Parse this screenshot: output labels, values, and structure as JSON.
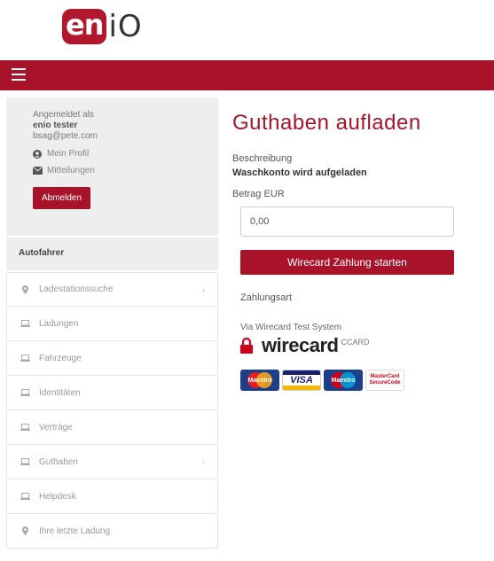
{
  "header": {
    "logo_part1": "en",
    "logo_part2": "iO"
  },
  "navbar": {
    "menu_icon": "hamburger-icon"
  },
  "user": {
    "logged_in_as": "Angemeldet als",
    "name": "enio tester",
    "email": "bsag@pete.com",
    "profile_label": "Mein Profil",
    "messages_label": "Mitteilungen",
    "logout_label": "Abmelden"
  },
  "sidebar": {
    "section_title": "Autofahrer",
    "items": [
      {
        "label": "Ladestationssuche",
        "icon": "map-pin-icon",
        "has_chevron": true
      },
      {
        "label": "Ladungen",
        "icon": "laptop-icon",
        "has_chevron": false
      },
      {
        "label": "Fahrzeuge",
        "icon": "laptop-icon",
        "has_chevron": false
      },
      {
        "label": "Identitäten",
        "icon": "laptop-icon",
        "has_chevron": false
      },
      {
        "label": "Verträge",
        "icon": "laptop-icon",
        "has_chevron": false
      },
      {
        "label": "Guthaben",
        "icon": "laptop-icon",
        "has_chevron": true
      },
      {
        "label": "Helpdesk",
        "icon": "laptop-icon",
        "has_chevron": false
      },
      {
        "label": "Ihre letzte Ladung",
        "icon": "map-pin-icon",
        "has_chevron": false
      }
    ]
  },
  "main": {
    "title": "Guthaben aufladen",
    "description_label": "Beschreibung",
    "description_value": "Waschkonto wird aufgeladen",
    "amount_label": "Betrag EUR",
    "amount_placeholder": "0,00",
    "pay_button": "Wirecard Zahlung starten",
    "payment_type_label": "Zahlungsart",
    "via_text": "Via Wirecard Test System",
    "wirecard_text": "wirecard",
    "ccard_text": "CCARD",
    "cards": [
      "Maestro",
      "VISA",
      "Maestro",
      "MasterCard SecureCode"
    ]
  },
  "colors": {
    "brand_red": "#a8132a"
  }
}
